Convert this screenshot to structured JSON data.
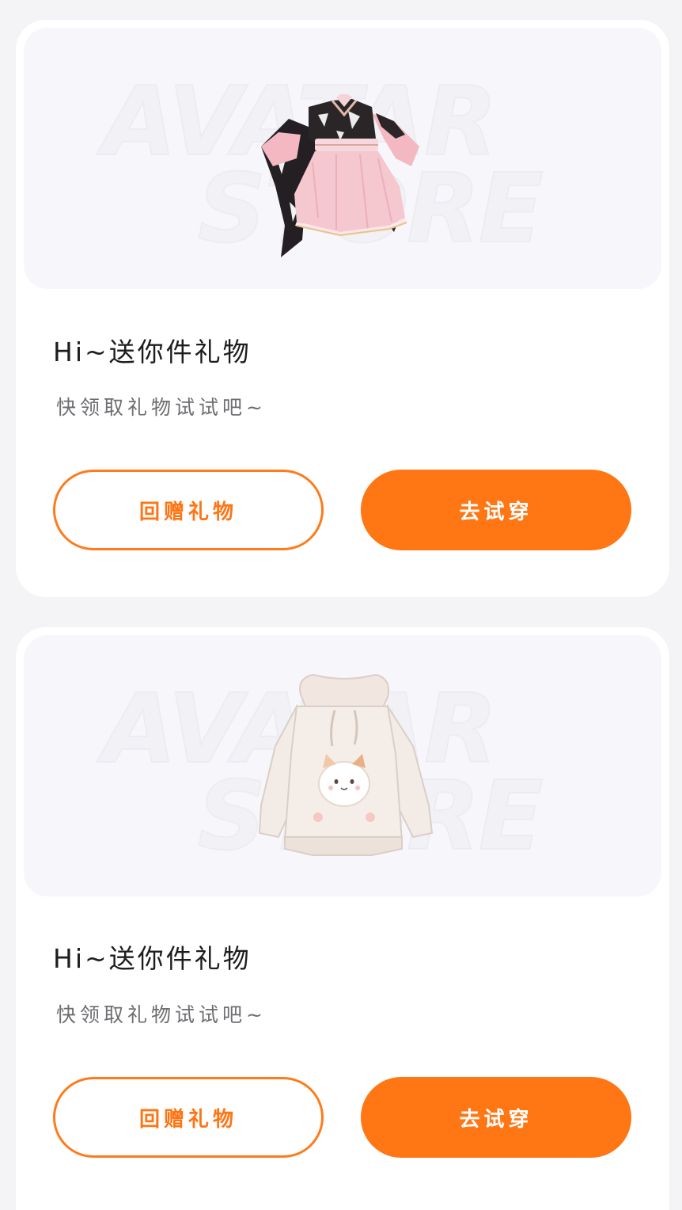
{
  "watermark": {
    "line1": "AVATAR",
    "line2": "STORE"
  },
  "cards": [
    {
      "product_icon": "kimono-dress-icon",
      "title": "Hi~送你件礼物",
      "subtitle": "快领取礼物试试吧~",
      "return_gift_label": "回赠礼物",
      "try_on_label": "去试穿"
    },
    {
      "product_icon": "cat-hoodie-icon",
      "title": "Hi~送你件礼物",
      "subtitle": "快领取礼物试试吧~",
      "return_gift_label": "回赠礼物",
      "try_on_label": "去试穿"
    }
  ],
  "colors": {
    "accent": "#ff7614",
    "title": "#1d1d1f",
    "subtitle": "#6e6e72",
    "background": "#f4f4f6"
  }
}
